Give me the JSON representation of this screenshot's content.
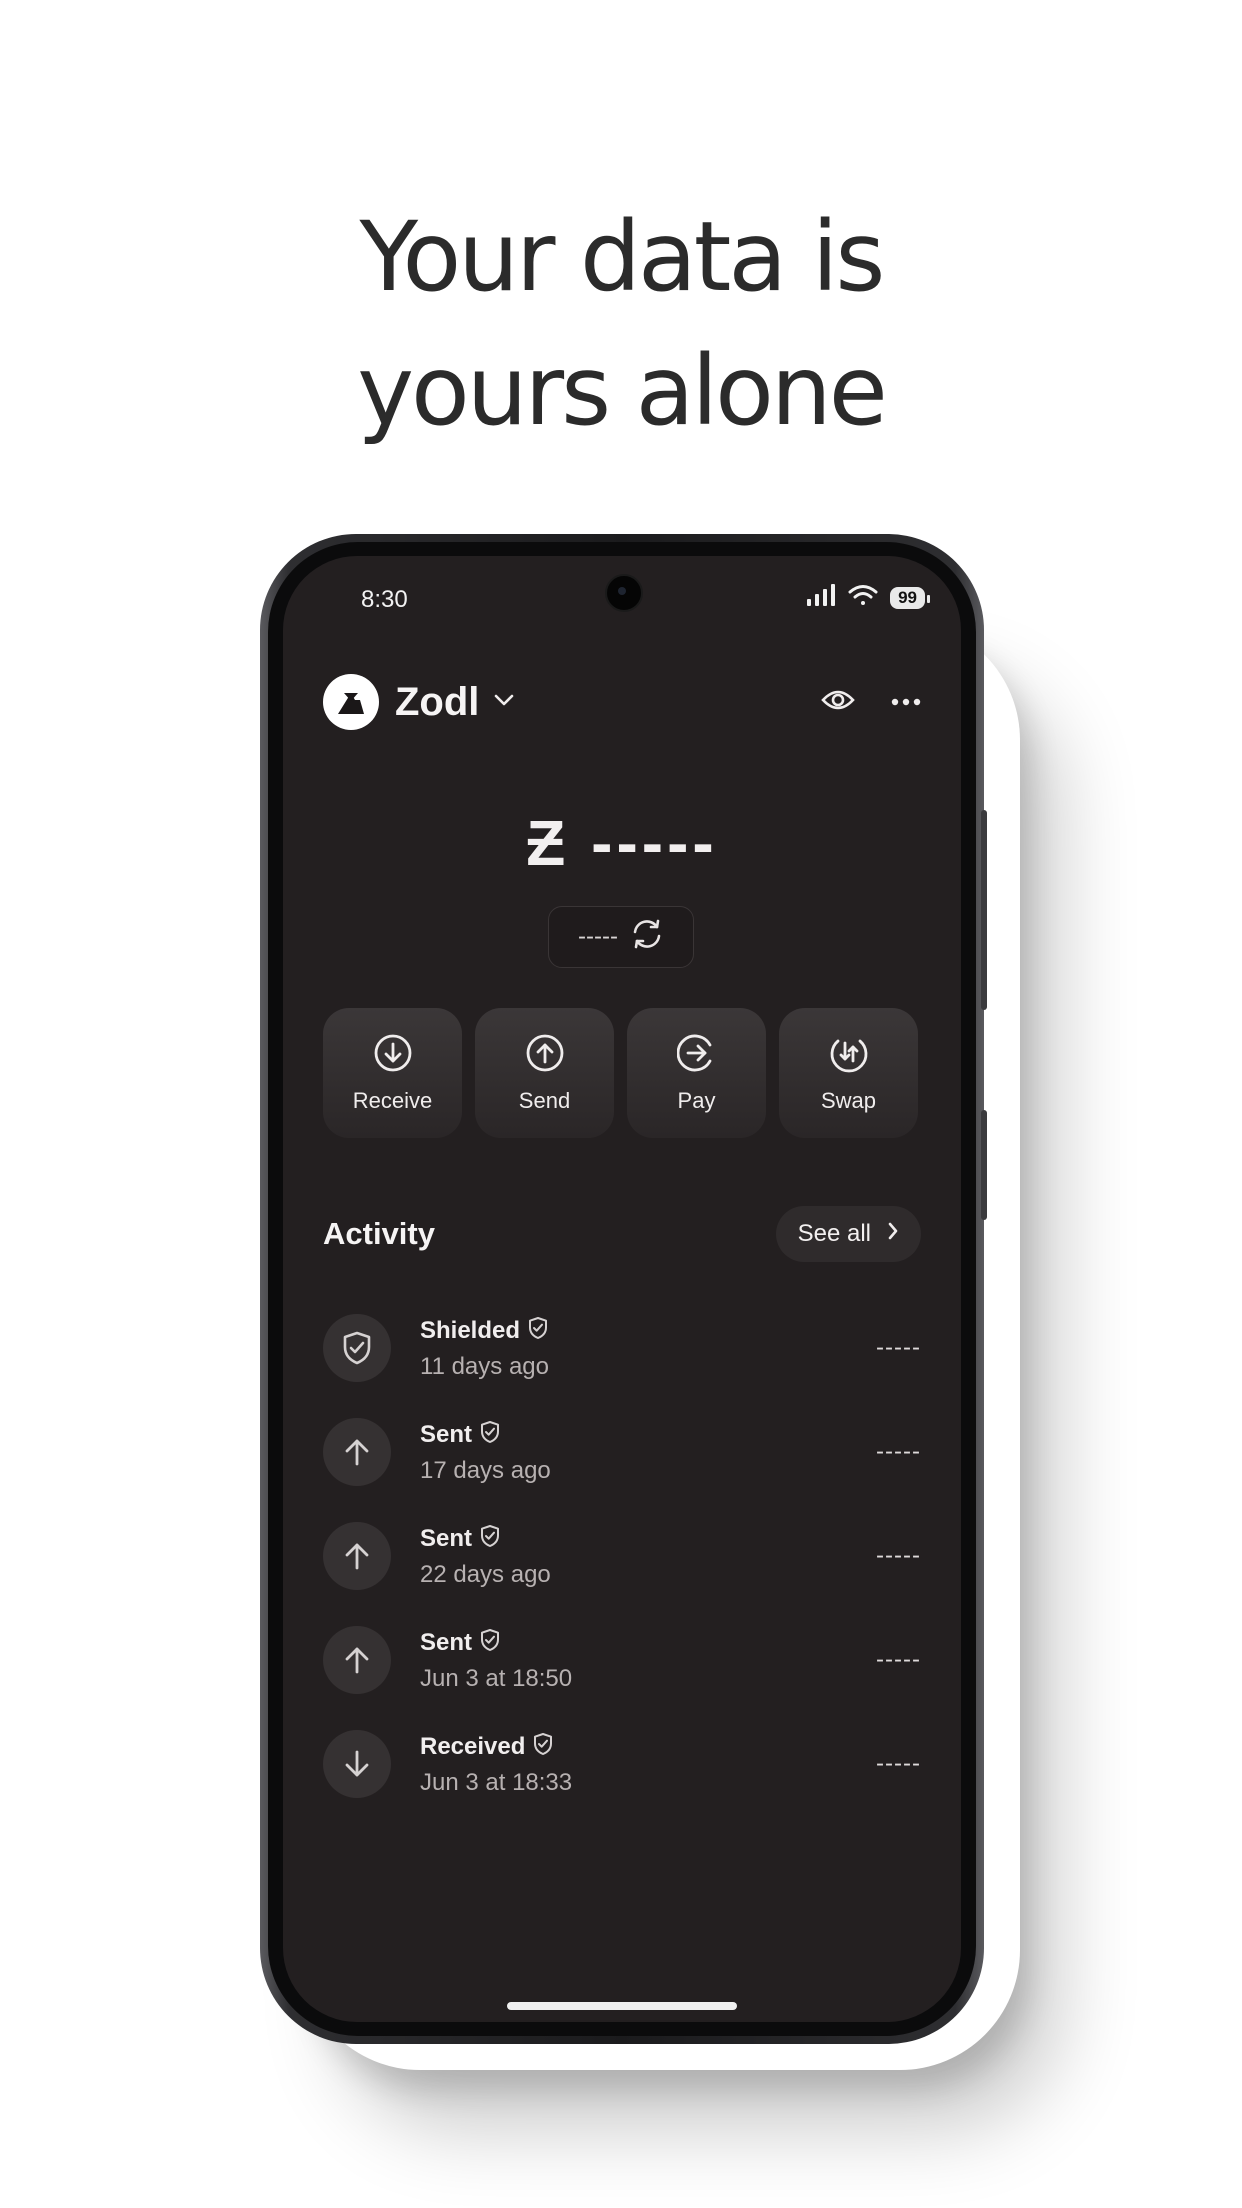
{
  "headline": {
    "line1": "Your data is",
    "line2": "yours alone"
  },
  "status_bar": {
    "time": "8:30",
    "battery": "99"
  },
  "header": {
    "wallet_name": "Zodl"
  },
  "balance": {
    "symbol": "Ƶ",
    "hidden_value": "-----",
    "fiat_hidden": "-----"
  },
  "actions": [
    {
      "label": "Receive",
      "icon": "arrow-down-circle-icon"
    },
    {
      "label": "Send",
      "icon": "arrow-up-circle-icon"
    },
    {
      "label": "Pay",
      "icon": "arrow-right-circle-icon"
    },
    {
      "label": "Swap",
      "icon": "swap-circle-icon"
    }
  ],
  "activity": {
    "title": "Activity",
    "see_all": "See all",
    "items": [
      {
        "title": "Shielded",
        "time": "11 days ago",
        "amount": "-----",
        "icon": "shield-check-icon"
      },
      {
        "title": "Sent",
        "time": "17 days ago",
        "amount": "-----",
        "icon": "arrow-up-icon"
      },
      {
        "title": "Sent",
        "time": "22 days ago",
        "amount": "-----",
        "icon": "arrow-up-icon"
      },
      {
        "title": "Sent",
        "time": "Jun 3 at 18:50",
        "amount": "-----",
        "icon": "arrow-up-icon"
      },
      {
        "title": "Received",
        "time": "Jun 3 at 18:33",
        "amount": "-----",
        "icon": "arrow-down-icon"
      }
    ]
  }
}
